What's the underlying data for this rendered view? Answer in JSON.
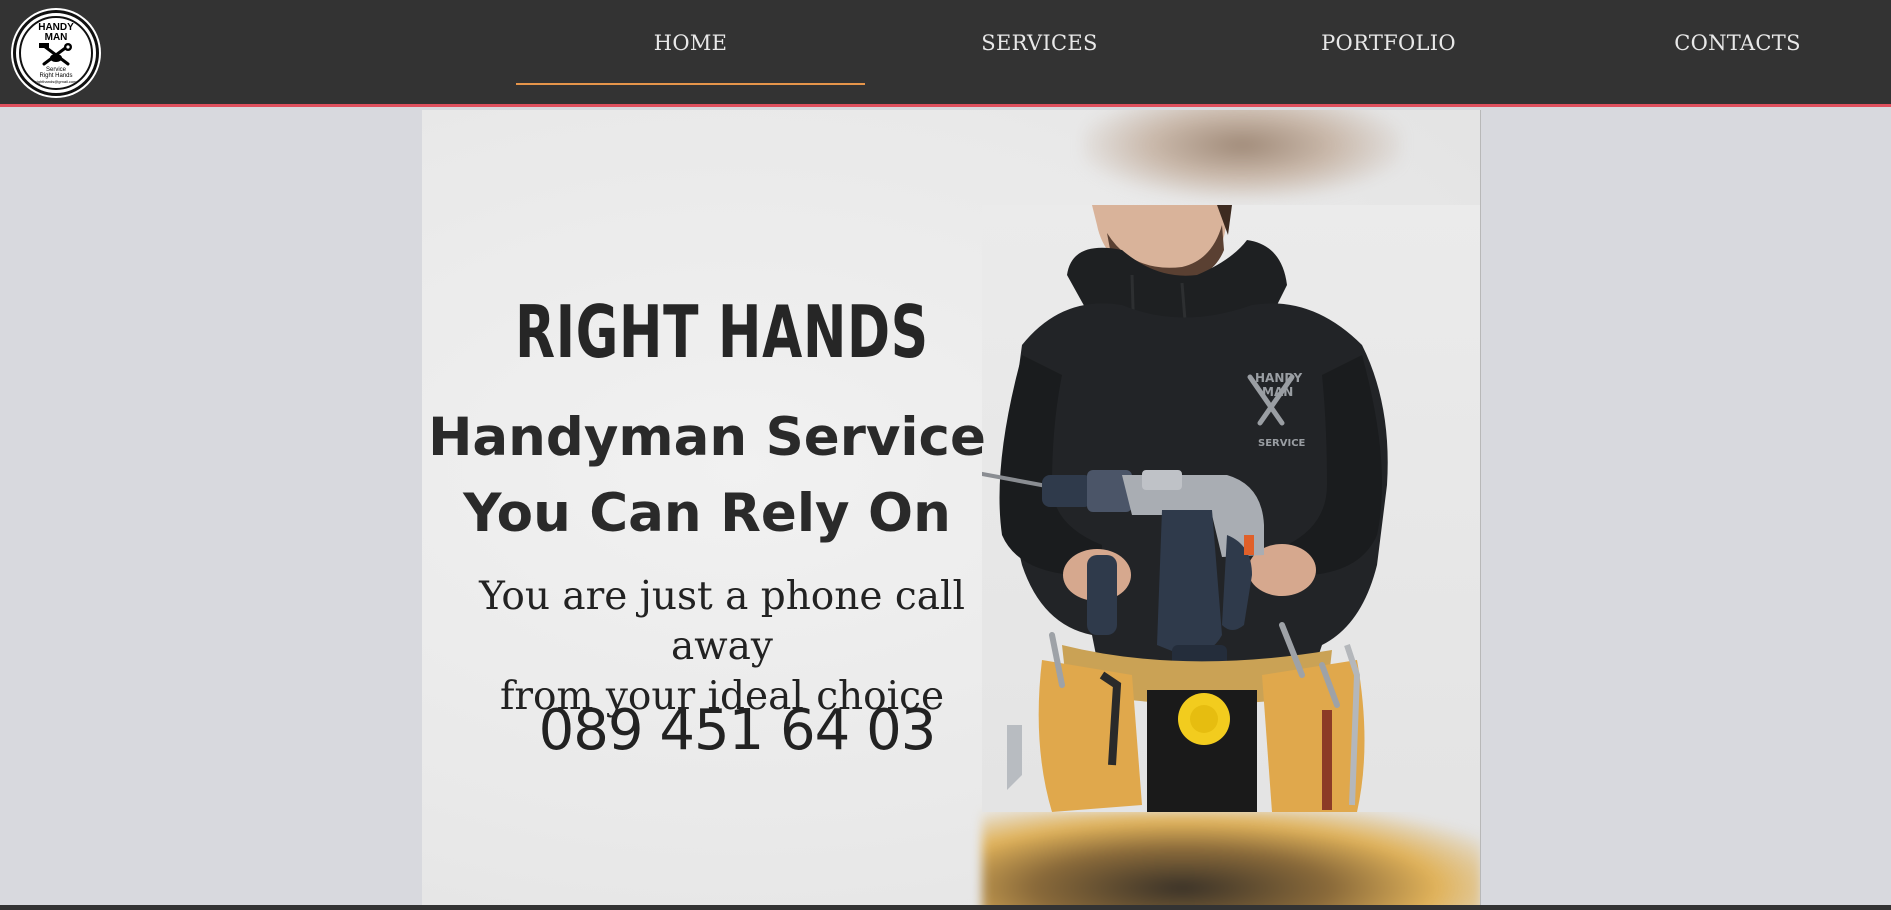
{
  "logo": {
    "title_line1": "HANDY",
    "title_line2": "MAN",
    "sub_line1": "Service",
    "sub_line2": "Right Hands",
    "email": "righthands@gmail.com"
  },
  "nav": {
    "items": [
      {
        "label": "HOME",
        "active": true
      },
      {
        "label": "SERVICES",
        "active": false
      },
      {
        "label": "PORTFOLIO",
        "active": false
      },
      {
        "label": "CONTACTS",
        "active": false
      }
    ]
  },
  "hero": {
    "brand": "RIGHT HANDS",
    "headline_line1": "Handyman Service",
    "headline_line2": "You Can Rely On",
    "tagline_line1": "You are just a phone call away",
    "tagline_line2": "from your ideal choice",
    "phone": "089 451 64 03",
    "hoodie_print_line1": "HANDY",
    "hoodie_print_line2": "MAN",
    "hoodie_print_line3": "SERVICE"
  },
  "colors": {
    "topbar": "#333333",
    "topbar_border": "#e0505e",
    "nav_active_underline": "#e6954a",
    "page_background": "#d8d9de",
    "hero_background": "#ececec",
    "text_dark": "#262626"
  },
  "icons": {
    "logo": "hammer-wrench-crossed-logo",
    "drill": "hammer-drill-illustration"
  }
}
